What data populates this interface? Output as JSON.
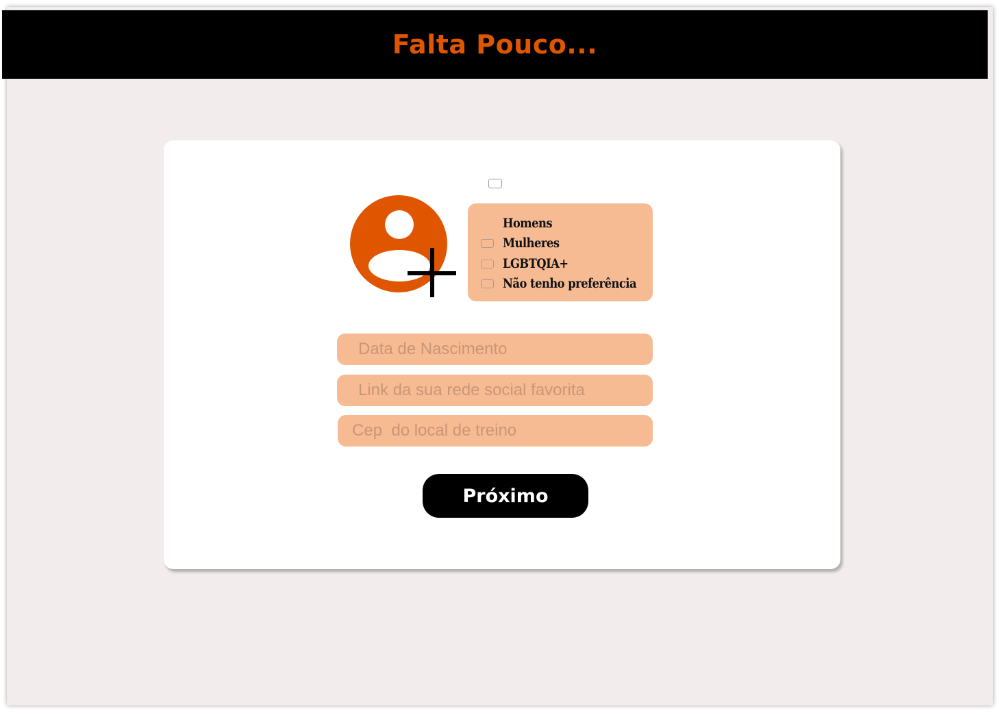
{
  "header": {
    "title": "Falta Pouco..."
  },
  "colors": {
    "accent": "#e05500",
    "peach": "#f6bb93",
    "background": "#f2ecec",
    "header_bg": "#000000"
  },
  "profile": {
    "avatar_icon": "user-add-icon"
  },
  "preferences": {
    "items": [
      {
        "label": "Homens",
        "checked": false
      },
      {
        "label": "Mulheres",
        "checked": false
      },
      {
        "label": "LGBTQIA+",
        "checked": false
      },
      {
        "label": "Não tenho preferência",
        "checked": false
      }
    ]
  },
  "form": {
    "birth_date": {
      "placeholder": "Data de Nascimento",
      "value": ""
    },
    "social_link": {
      "placeholder": "Link da sua rede social favorita",
      "value": ""
    },
    "cep": {
      "placeholder": "Cep  do local de treino",
      "value": ""
    }
  },
  "actions": {
    "next_label": "Próximo"
  }
}
